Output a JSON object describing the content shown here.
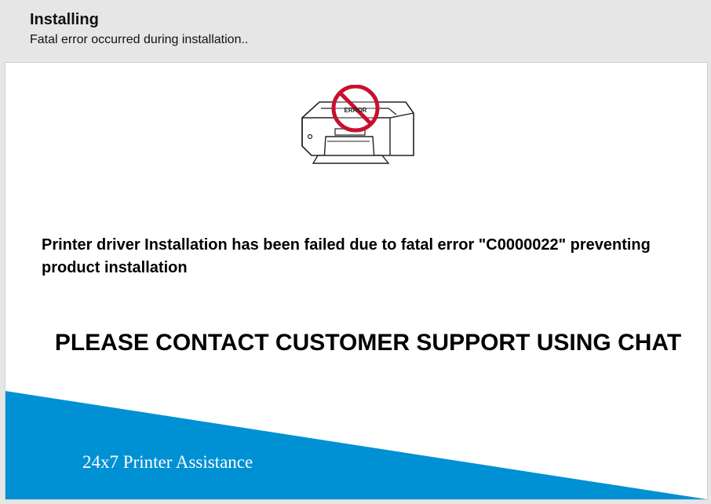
{
  "header": {
    "title": "Installing",
    "subtitle": "Fatal error occurred during installation.."
  },
  "printer_graphic": {
    "icon": "printer-error-icon",
    "error_label": "ERROR"
  },
  "main": {
    "error_message": "Printer driver Installation has been failed due to fatal error \"C0000022\" preventing product installation",
    "support_message": "PLEASE CONTACT CUSTOMER SUPPORT USING CHAT"
  },
  "footer": {
    "brand_text": "24x7 Printer Assistance"
  },
  "colors": {
    "background": "#e6e6e6",
    "panel": "#ffffff",
    "accent_blue": "#0091d5",
    "error_red": "#c8102e"
  }
}
